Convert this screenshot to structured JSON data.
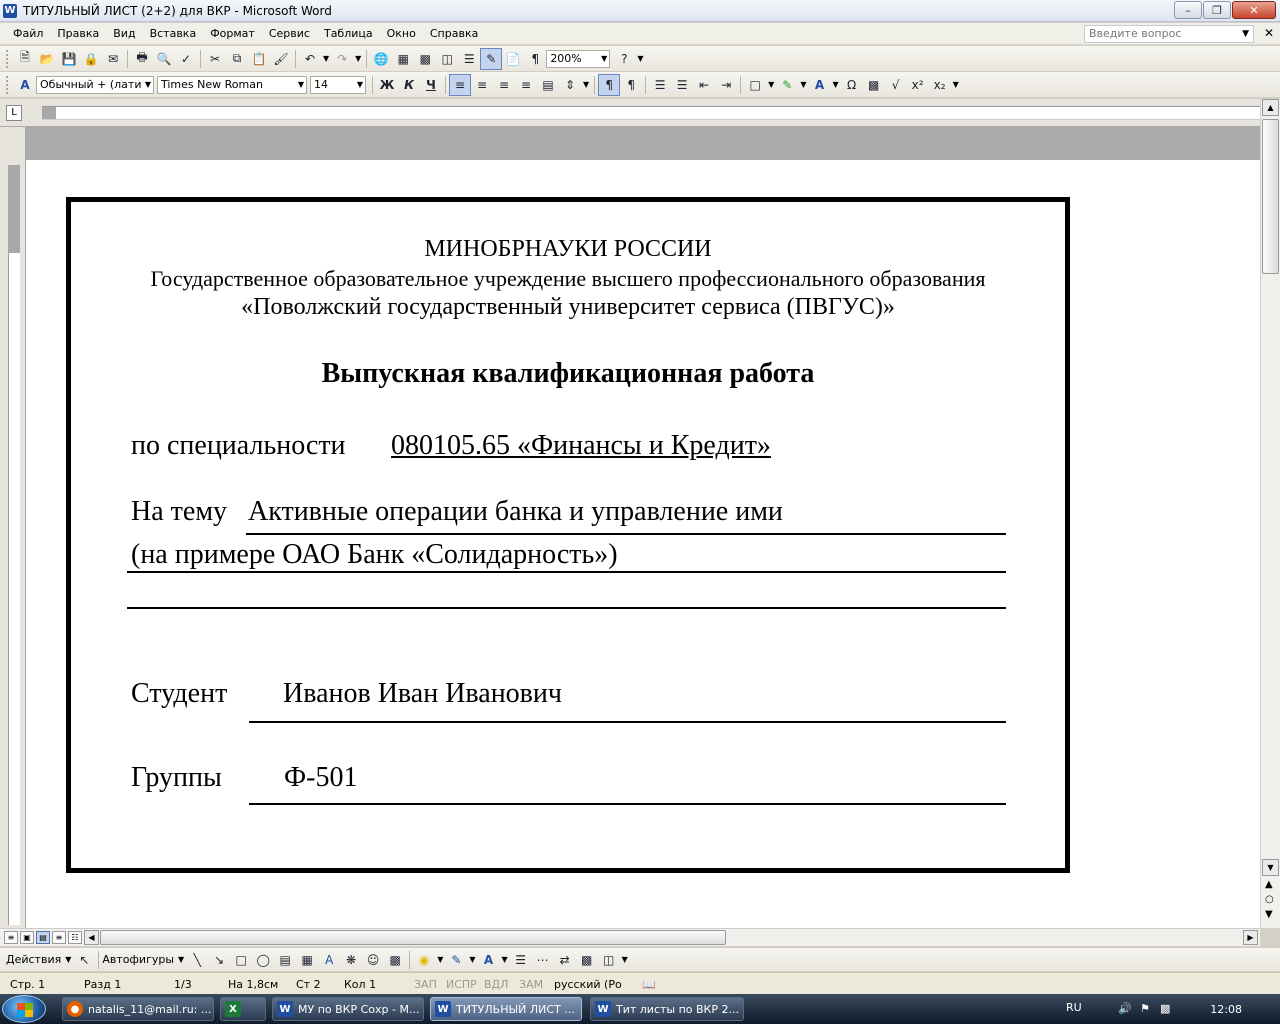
{
  "window": {
    "app_icon": "W",
    "title": "ТИТУЛЬНЫЙ ЛИСТ (2+2) для ВКР - Microsoft Word"
  },
  "menu": {
    "items": [
      "Файл",
      "Правка",
      "Вид",
      "Вставка",
      "Формат",
      "Сервис",
      "Таблица",
      "Окно",
      "Справка"
    ],
    "ask_placeholder": "Введите вопрос"
  },
  "toolbar_standard": {
    "zoom": "200%"
  },
  "toolbar_formatting": {
    "style": "Обычный + (лати",
    "font": "Times New Roman",
    "size": "14"
  },
  "document": {
    "line1": "МИНОБРНАУКИ РОССИИ",
    "line2": "Государственное образовательное учреждение высшего профессионального образования",
    "line3": "«Поволжский  государственный университет  сервиса (ПВГУС)»",
    "heading": "Выпускная  квалификационная  работа",
    "specialty_label": "по специальности",
    "specialty_value": "080105.65 «Финансы и Кредит»",
    "topic_label": "На тему",
    "topic_value": "Активные операции банка и управление ими",
    "topic_line2": "(на примере  ОАО Банк «Солидарность»)",
    "student_label": "Студент",
    "student_value": "Иванов Иван Иванович",
    "group_label": "Группы",
    "group_value": "Ф-501"
  },
  "drawing_toolbar": {
    "actions": "Действия",
    "autoshapes": "Автофигуры"
  },
  "status": {
    "page": "Стр. 1",
    "section": "Разд  1",
    "pages": "1/3",
    "at": "На  1,8см",
    "line": "Ст  2",
    "col": "Кол  1",
    "rec": "ЗАП",
    "trk": "ИСПР",
    "ext": "ВДЛ",
    "ovr": "ЗАМ",
    "language": "русский (Ро"
  },
  "taskbar": {
    "tasks": [
      {
        "label": "natalis_11@mail.ru: ...",
        "icon": "firefox"
      },
      {
        "label": "",
        "icon": "excel"
      },
      {
        "label": "МУ по ВКР Сохр - М...",
        "icon": "word"
      },
      {
        "label": "ТИТУЛЬНЫЙ ЛИСТ ...",
        "icon": "word"
      },
      {
        "label": "Тит листы по ВКР 2...",
        "icon": "word"
      }
    ],
    "lang": "RU",
    "clock": "12:08"
  }
}
